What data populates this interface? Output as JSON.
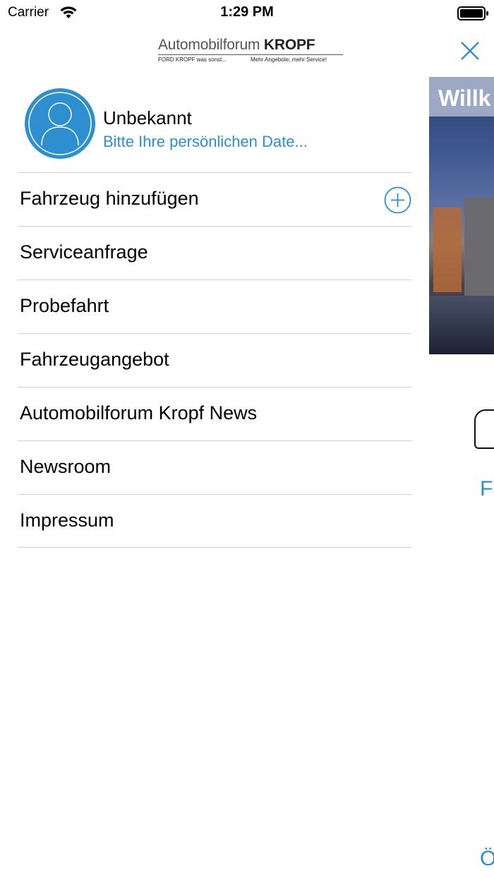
{
  "status_bar": {
    "carrier": "Carrier",
    "time": "1:29 PM"
  },
  "logo": {
    "brand_light": "Automobilforum ",
    "brand_bold": "KROPF",
    "tagline_left": "FORD KROPF was sonst...",
    "tagline_right": "Mehr Angebote, mehr Service!"
  },
  "profile": {
    "name": "Unbekannt",
    "subtitle": "Bitte Ihre persönlichen Date..."
  },
  "menu": {
    "items": [
      {
        "label": "Fahrzeug hinzufügen",
        "icon": "plus-circle-icon"
      },
      {
        "label": "Serviceanfrage"
      },
      {
        "label": "Probefahrt"
      },
      {
        "label": "Fahrzeugangebot"
      },
      {
        "label": "Automobilforum Kropf News"
      },
      {
        "label": "Newsroom"
      },
      {
        "label": "Impressum"
      }
    ]
  },
  "background": {
    "hero_title": "Willk",
    "feature_label": "Fa",
    "bottom_label": "Ö"
  },
  "colors": {
    "accent": "#2e8fd0",
    "divider": "#cfcfcf"
  }
}
